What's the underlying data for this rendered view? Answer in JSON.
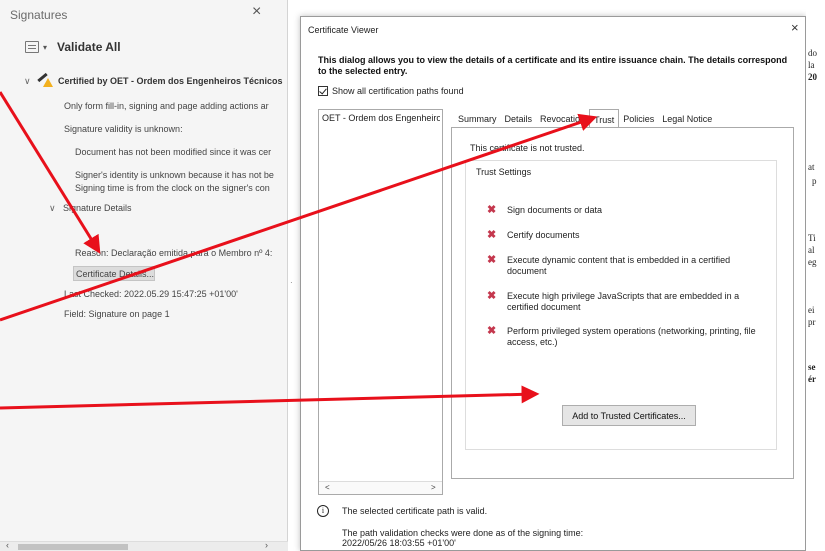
{
  "panel": {
    "title": "Signatures",
    "close": "×",
    "validate_all": "Validate All",
    "certified_by": "Certified by OET - Ordem dos Engenheiros Técnicos",
    "lines": {
      "form_fill": "Only form fill-in, signing and page adding actions ar",
      "validity_unknown": "Signature validity is unknown:",
      "not_modified": "Document has not been modified since it was cer",
      "identity_unknown": "Signer's identity is unknown because it has not be",
      "signing_time": "Signing time is from the clock on the signer's con",
      "sig_details": "Signature Details",
      "reason": "Reason: Declaração emitida para o  Membro nº 4:",
      "cert_details": "Certificate Details...",
      "last_checked": "Last Checked: 2022.05.29 15:47:25 +01'00'",
      "field": "Field: Signature on page 1"
    }
  },
  "dialog": {
    "title": "Certificate Viewer",
    "close": "×",
    "description": "This dialog allows you to view the details of a certificate and its entire issuance chain. The details correspond to the selected entry.",
    "show_all": "Show all certification paths found",
    "tree_item": "OET - Ordem dos Engenheiros",
    "tabs": [
      "Summary",
      "Details",
      "Revocation",
      "Trust",
      "Policies",
      "Legal Notice"
    ],
    "not_trusted": "This certificate is not trusted.",
    "trust_settings": "Trust Settings",
    "trust_items": [
      "Sign documents or data",
      "Certify documents",
      "Execute dynamic content that is embedded in a certified document",
      "Execute high privilege JavaScripts that are embedded in a certified document",
      "Perform privileged system operations (networking, printing, file access, etc.)"
    ],
    "add_button": "Add to Trusted Certificates...",
    "path_valid": "The selected certificate path is valid.",
    "path_check_line1": "The path validation checks were done as of the signing time:",
    "path_check_line2": "2022/05/26 18:03:55 +01'00'"
  },
  "doc_fragments": [
    "do",
    "la",
    "20",
    "at",
    "p",
    "Ti",
    "al",
    "eg",
    "ei",
    "pr",
    "se",
    "ér"
  ],
  "colors": {
    "arrow": "#e8101b",
    "x_mark": "#c4374d"
  }
}
